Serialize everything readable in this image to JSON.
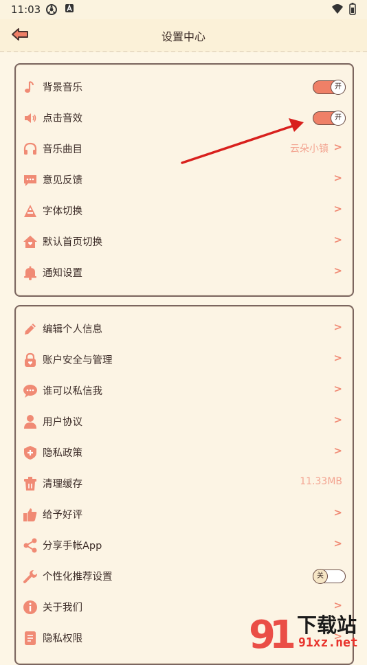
{
  "status_bar": {
    "time": "11:03"
  },
  "header": {
    "title": "设置中心"
  },
  "colors": {
    "accent": "#ef8067",
    "border": "#7b6660",
    "background": "#fdf6e6"
  },
  "card1": {
    "items": [
      {
        "label": "背景音乐",
        "control": "toggle",
        "state": "开",
        "icon": "music-note-icon"
      },
      {
        "label": "点击音效",
        "control": "toggle",
        "state": "开",
        "icon": "speaker-icon"
      },
      {
        "label": "音乐曲目",
        "value": "云朵小镇",
        "icon": "headphones-icon"
      },
      {
        "label": "意见反馈",
        "icon": "chat-bubble-icon"
      },
      {
        "label": "字体切换",
        "icon": "font-icon"
      },
      {
        "label": "默认首页切换",
        "icon": "home-icon"
      },
      {
        "label": "通知设置",
        "icon": "bell-icon"
      }
    ]
  },
  "card2": {
    "items": [
      {
        "label": "编辑个人信息",
        "icon": "pencil-icon"
      },
      {
        "label": "账户安全与管理",
        "icon": "lock-icon"
      },
      {
        "label": "谁可以私信我",
        "icon": "message-icon"
      },
      {
        "label": "用户协议",
        "icon": "person-icon"
      },
      {
        "label": "隐私政策",
        "icon": "shield-icon"
      },
      {
        "label": "清理缓存",
        "value": "11.33MB",
        "icon": "trash-icon"
      },
      {
        "label": "给予好评",
        "icon": "thumbs-up-icon"
      },
      {
        "label": "分享手帐App",
        "icon": "share-icon"
      },
      {
        "label": "个性化推荐设置",
        "control": "toggle",
        "state": "关",
        "icon": "wrench-icon"
      },
      {
        "label": "关于我们",
        "icon": "info-icon"
      },
      {
        "label": "隐私权限",
        "icon": "document-icon"
      }
    ]
  },
  "chevron": ">",
  "watermark": {
    "text_top": "下载站",
    "text_bottom": "91xz.net"
  }
}
